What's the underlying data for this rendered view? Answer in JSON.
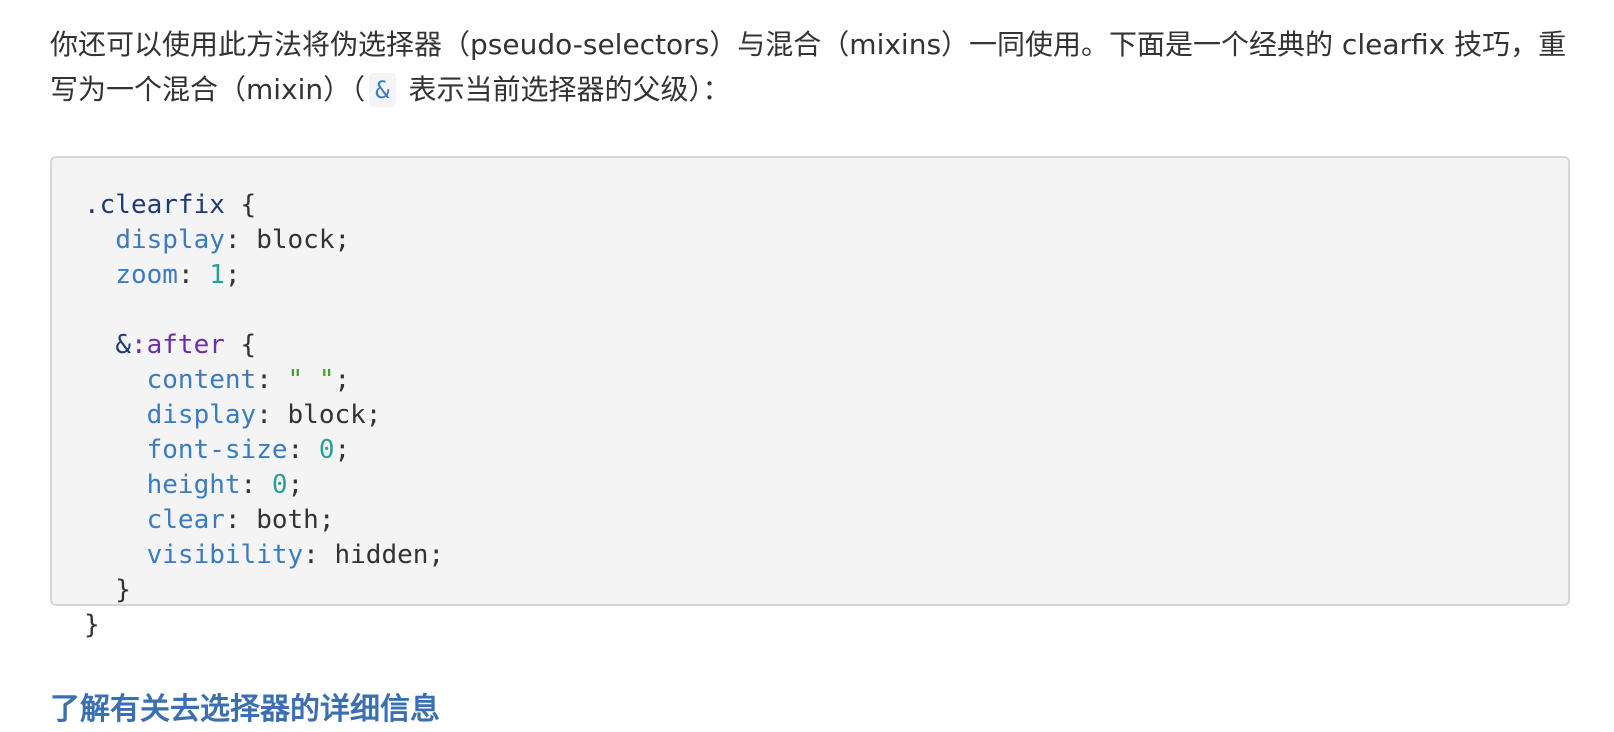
{
  "intro": {
    "before_code": "你还可以使用此方法将伪选择器（pseudo-selectors）与混合（mixins）一同使用。下面是一个经典的 clearfix 技巧，重写为一个混合（mixin）（",
    "inline_code": "&",
    "after_code": " 表示当前选择器的父级）："
  },
  "code": {
    "line1": {
      "selector": ".clearfix",
      "rest": " {"
    },
    "line2": {
      "indent": "  ",
      "prop": "display",
      "sep": ": ",
      "value": "block",
      "end": ";"
    },
    "line3": {
      "indent": "  ",
      "prop": "zoom",
      "sep": ": ",
      "num": "1",
      "end": ";"
    },
    "line4": "",
    "line5": {
      "indent": "  ",
      "amp": "&",
      "pseudo": ":after",
      "rest": " {"
    },
    "line6": {
      "indent": "    ",
      "prop": "content",
      "sep": ": ",
      "str": "\" \"",
      "end": ";"
    },
    "line7": {
      "indent": "    ",
      "prop": "display",
      "sep": ": ",
      "value": "block",
      "end": ";"
    },
    "line8": {
      "indent": "    ",
      "prop": "font-size",
      "sep": ": ",
      "num": "0",
      "end": ";"
    },
    "line9": {
      "indent": "    ",
      "prop": "height",
      "sep": ": ",
      "num": "0",
      "end": ";"
    },
    "line10": {
      "indent": "    ",
      "prop": "clear",
      "sep": ": ",
      "value": "both",
      "end": ";"
    },
    "line11": {
      "indent": "    ",
      "prop": "visibility",
      "sep": ": ",
      "value": "hidden",
      "end": ";"
    },
    "line12": "  }",
    "line13": "}"
  },
  "more_link": "了解有关去选择器的详细信息"
}
